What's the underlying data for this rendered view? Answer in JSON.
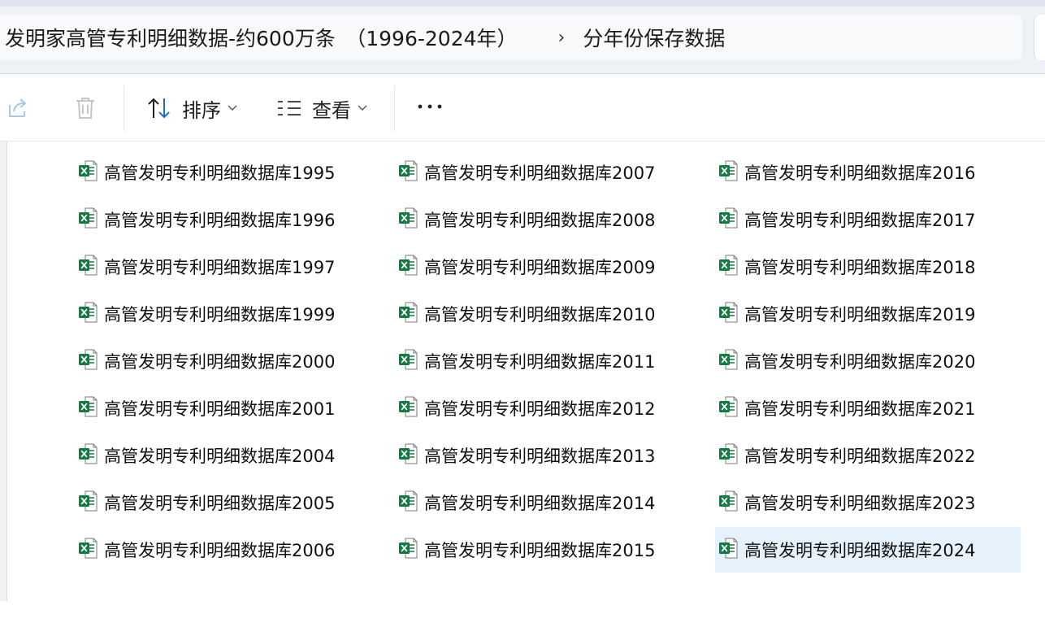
{
  "address": {
    "path": [
      "发明家高管专利明细数据-约600万条　（1996-2024年）",
      "分年份保存数据"
    ],
    "separator": "›"
  },
  "toolbar": {
    "share_icon": "share-icon",
    "delete_icon": "trash-icon",
    "sort_label": "排序",
    "view_label": "查看",
    "more_label": "···"
  },
  "files": {
    "columns": [
      [
        "高管发明专利明细数据库1995",
        "高管发明专利明细数据库1996",
        "高管发明专利明细数据库1997",
        "高管发明专利明细数据库1999",
        "高管发明专利明细数据库2000",
        "高管发明专利明细数据库2001",
        "高管发明专利明细数据库2004",
        "高管发明专利明细数据库2005",
        "高管发明专利明细数据库2006"
      ],
      [
        "高管发明专利明细数据库2007",
        "高管发明专利明细数据库2008",
        "高管发明专利明细数据库2009",
        "高管发明专利明细数据库2010",
        "高管发明专利明细数据库2011",
        "高管发明专利明细数据库2012",
        "高管发明专利明细数据库2013",
        "高管发明专利明细数据库2014",
        "高管发明专利明细数据库2015"
      ],
      [
        "高管发明专利明细数据库2016",
        "高管发明专利明细数据库2017",
        "高管发明专利明细数据库2018",
        "高管发明专利明细数据库2019",
        "高管发明专利明细数据库2020",
        "高管发明专利明细数据库2021",
        "高管发明专利明细数据库2022",
        "高管发明专利明细数据库2023",
        "高管发明专利明细数据库2024"
      ]
    ],
    "selected": "高管发明专利明细数据库2024",
    "file_icon": "excel-file-icon"
  },
  "colors": {
    "accent": "#0067c0",
    "excel_green": "#107c41",
    "selected_bg": "#e5f1fb"
  }
}
